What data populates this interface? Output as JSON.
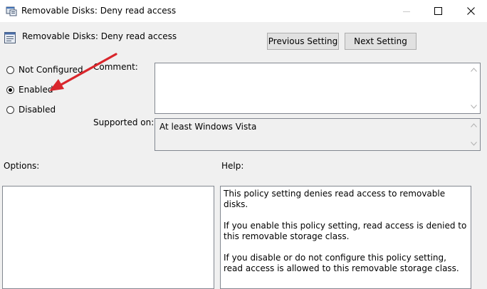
{
  "window": {
    "title": "Removable Disks: Deny read access",
    "controls": {
      "minimize_icon": "minimize-icon",
      "maximize_icon": "maximize-icon",
      "close_icon": "close-icon"
    }
  },
  "header": {
    "policy_name": "Removable Disks: Deny read access",
    "previous_label": "Previous Setting",
    "next_label": "Next Setting"
  },
  "state": {
    "options": [
      {
        "label": "Not Configured",
        "selected": false
      },
      {
        "label": "Enabled",
        "selected": true
      },
      {
        "label": "Disabled",
        "selected": false
      }
    ]
  },
  "comment": {
    "label": "Comment:",
    "value": ""
  },
  "supported": {
    "label": "Supported on:",
    "value": "At least Windows Vista"
  },
  "options_pane": {
    "label": "Options:"
  },
  "help_pane": {
    "label": "Help:",
    "paragraphs": [
      "This policy setting denies read access to removable disks.",
      "If you enable this policy setting, read access is denied to this removable storage class.",
      "If you disable or do not configure this policy setting, read access is allowed to this removable storage class."
    ]
  },
  "annotation": {
    "color": "#d9262c"
  }
}
